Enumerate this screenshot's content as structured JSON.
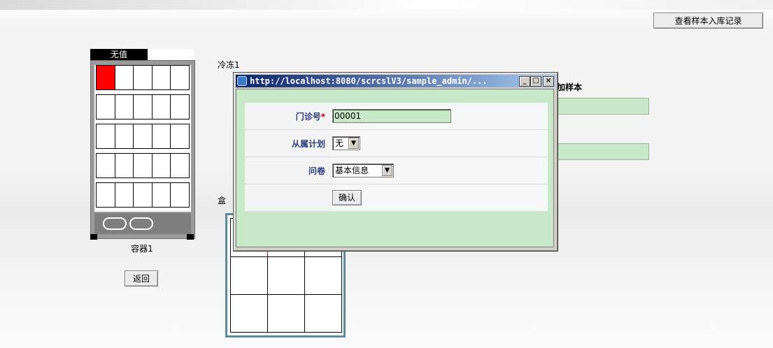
{
  "header": {
    "records_button": "查看样本入库记录"
  },
  "container": {
    "title": "无值",
    "label": "容器1",
    "back_button": "返回",
    "rows": 5,
    "cols": 5,
    "filled_cells": [
      [
        0,
        0
      ]
    ]
  },
  "box": {
    "label": "冷冻1",
    "label2": "盒"
  },
  "behind": {
    "header_text": "加样本"
  },
  "popup": {
    "title": "http://localhost:8080/scrcslV3/sample_admin/...",
    "fields": {
      "clinic_no_label": "门诊号",
      "required_mark": "*",
      "clinic_no_value": "00001",
      "plan_label": "从属计划",
      "plan_value": "无",
      "questionnaire_label": "问卷",
      "questionnaire_value": "基本信息"
    },
    "confirm_button": "确认",
    "minimize": "_",
    "maximize": "□",
    "close": "×"
  },
  "colors": {
    "field_bg": "#c7e9c7",
    "filled_cell": "#ff0000",
    "titlebar_start": "#0a246a",
    "titlebar_end": "#a6caf0"
  }
}
